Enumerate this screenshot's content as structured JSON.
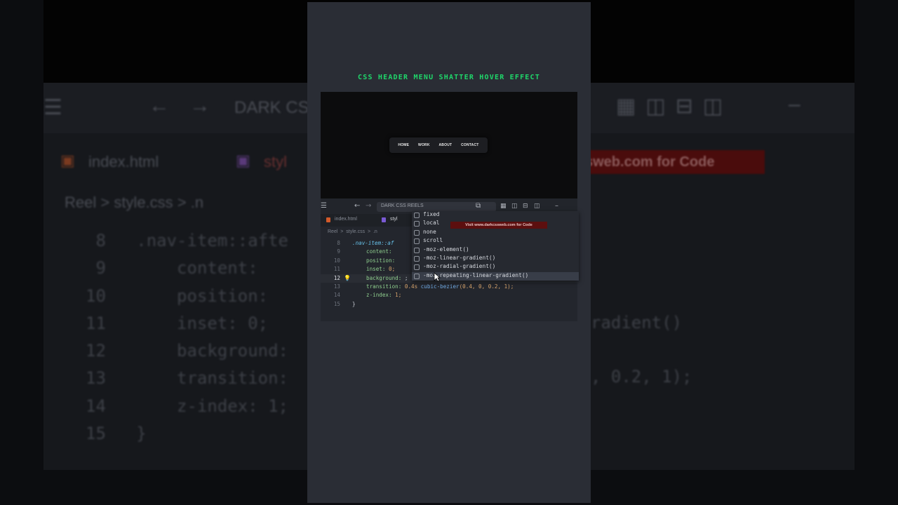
{
  "backdrop": {
    "breadcrumb": "Reel > style.css > .n",
    "tab1": "index.html",
    "tab2": "styl",
    "search": "DARK CS",
    "banner": "sweb.com for Code",
    "lines": [
      {
        "n": "8",
        "text": ".nav-item::afte"
      },
      {
        "n": "9",
        "text": "    content: "
      },
      {
        "n": "10",
        "text": "    position:"
      },
      {
        "n": "11",
        "text": "    inset: 0;"
      },
      {
        "n": "12",
        "text": "    background:"
      },
      {
        "n": "13",
        "text": "    transition:"
      },
      {
        "n": "14",
        "text": "    z-index: 1;"
      },
      {
        "n": "15",
        "text": "}"
      }
    ],
    "right_texts": [
      "radient()",
      ", 0.2, 1);"
    ]
  },
  "reel": {
    "title": "CSS HEADER MENU SHATTER HOVER EFFECT",
    "nav": [
      "HOME",
      "WORK",
      "ABOUT",
      "CONTACT"
    ],
    "editor": {
      "search_text": "DARK CSS REELS",
      "tabs": [
        "index.html",
        "styl"
      ],
      "breadcrumb": "Reel  >  style.css  >  .n",
      "banner": "Visit www.darkcssweb.com for Code",
      "lines": [
        {
          "n": "8",
          "selector": ".nav-item::af",
          "rest": ""
        },
        {
          "n": "9",
          "prop": "content:",
          "rest": ""
        },
        {
          "n": "10",
          "prop": "position:",
          "rest": ""
        },
        {
          "n": "11",
          "prop": "inset:",
          "rest": " 0;"
        },
        {
          "n": "12",
          "prop": "background:",
          "rest": " ;"
        },
        {
          "n": "13",
          "prop": "transition:",
          "val": " 0.4s ",
          "fn": "cubic-bezier",
          "rest": "(0.4, 0, 0.2, 1);"
        },
        {
          "n": "14",
          "prop": "z-index:",
          "rest": " 1;"
        },
        {
          "n": "15",
          "rest": "}"
        }
      ],
      "autocomplete": [
        "fixed",
        "local",
        "none",
        "scroll",
        "-moz-element()",
        "-moz-linear-gradient()",
        "-moz-radial-gradient()",
        "-moz-repeating-linear-gradient()"
      ],
      "autocomplete_highlighted": 7
    }
  }
}
